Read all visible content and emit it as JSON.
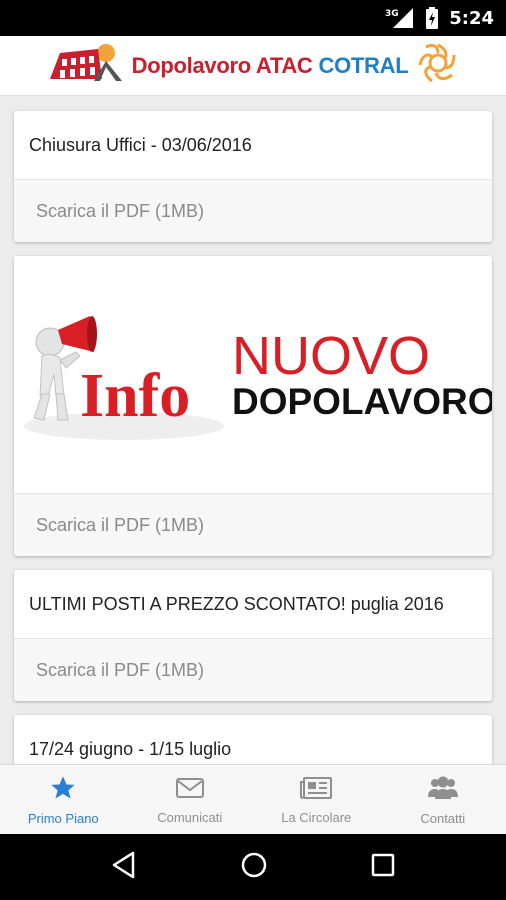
{
  "status_bar": {
    "network": "3G",
    "time": "5:24"
  },
  "header": {
    "brand_part1": "Dopolavoro ATAC",
    "brand_part2": "COTRAL"
  },
  "cards": [
    {
      "title": "Chiusura Uffici - 03/06/2016",
      "action": "Scarica il PDF (1MB)"
    },
    {
      "image_headline_1": "NUOVO",
      "image_headline_2": "DOPOLAVORO",
      "image_word": "Info",
      "action": "Scarica il PDF (1MB)"
    },
    {
      "title": "ULTIMI POSTI A PREZZO SCONTATO! puglia 2016",
      "action": "Scarica il PDF (1MB)"
    },
    {
      "title": "17/24 giugno - 1/15 luglio"
    }
  ],
  "bottom_nav": [
    {
      "label": "Primo Piano",
      "icon": "star-icon",
      "active": true
    },
    {
      "label": "Comunicati",
      "icon": "envelope-icon",
      "active": false
    },
    {
      "label": "La Circolare",
      "icon": "newspaper-icon",
      "active": false
    },
    {
      "label": "Contatti",
      "icon": "users-icon",
      "active": false
    }
  ],
  "colors": {
    "accent": "#2a7fd4",
    "brand_red": "#c8202f",
    "brand_blue": "#1f80c8"
  }
}
